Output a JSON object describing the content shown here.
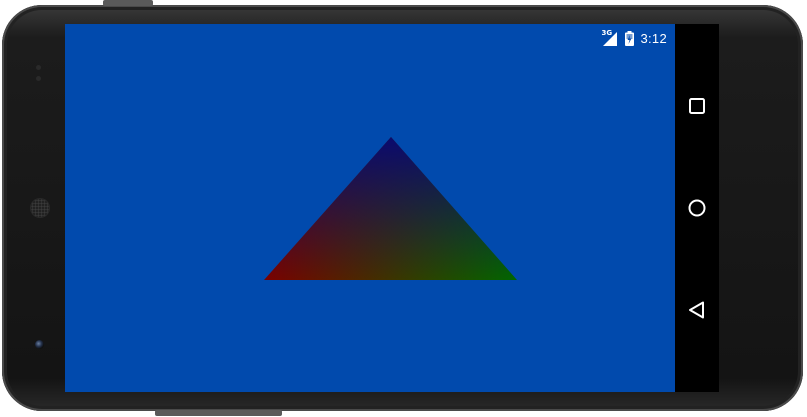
{
  "status_bar": {
    "network_type": "3G",
    "signal_icon": "cell-signal-icon",
    "battery_icon": "battery-charging-icon",
    "time": "3:12"
  },
  "colors": {
    "screen_background": "#014aad",
    "triangle_top": "#0a0a6e",
    "triangle_left": "#7a0000",
    "triangle_right": "#006600"
  },
  "nav_bar": {
    "recent_icon": "recent-apps-square-icon",
    "home_icon": "home-circle-icon",
    "back_icon": "back-triangle-icon"
  }
}
